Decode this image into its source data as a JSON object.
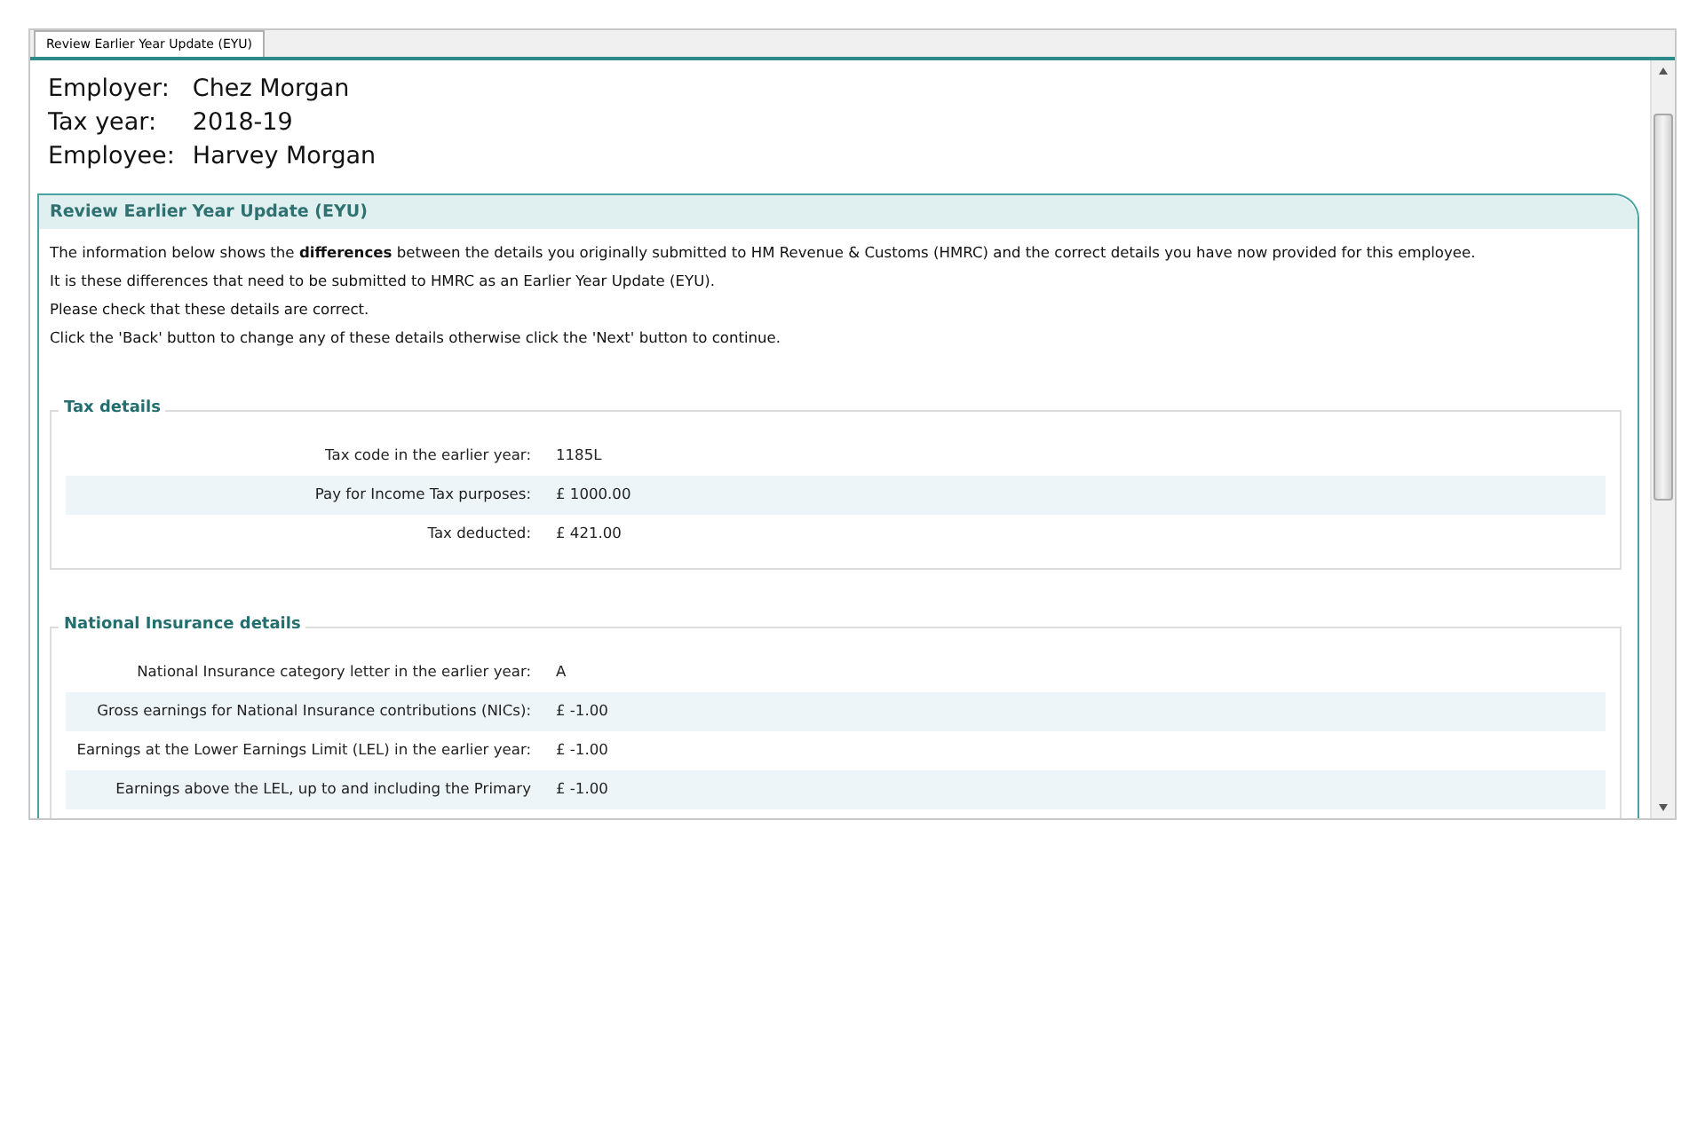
{
  "tabs": [
    {
      "label": "Review Earlier Year Update (EYU)",
      "selected": true
    }
  ],
  "header": [
    {
      "label": "Employer:",
      "value": "Chez Morgan"
    },
    {
      "label": "Tax year:",
      "value": "2018-19"
    },
    {
      "label": "Employee:",
      "value": "Harvey Morgan"
    }
  ],
  "panel": {
    "title": "Review Earlier Year Update (EYU)",
    "paragraphs": [
      "The information below shows the **differences** between the details you originally submitted to HM Revenue & Customs (HMRC) and the correct details you have now provided for this employee.",
      "It is these differences that need to be submitted to HMRC as an Earlier Year Update (EYU).",
      "Please check that these details are correct.",
      "Click the 'Back' button to change any of these details otherwise click the 'Next' button to continue."
    ],
    "sections": [
      {
        "title": "Tax details",
        "rows": [
          {
            "label": "Tax code in the earlier year:",
            "value": "1185L"
          },
          {
            "label": "Pay for Income Tax purposes:",
            "value": "£ 1000.00"
          },
          {
            "label": "Tax deducted:",
            "value": "£ 421.00"
          }
        ]
      },
      {
        "title": "National Insurance details",
        "rows": [
          {
            "label": "National Insurance category letter in the earlier year:",
            "value": "A"
          },
          {
            "label": "Gross earnings for National Insurance contributions (NICs):",
            "value": "£ -1.00"
          },
          {
            "label": "Earnings at the Lower Earnings Limit (LEL) in the earlier year:",
            "value": "£ -1.00"
          },
          {
            "label": "Earnings above the LEL, up to and including the Primary",
            "value": "£ -1.00"
          }
        ]
      }
    ]
  }
}
